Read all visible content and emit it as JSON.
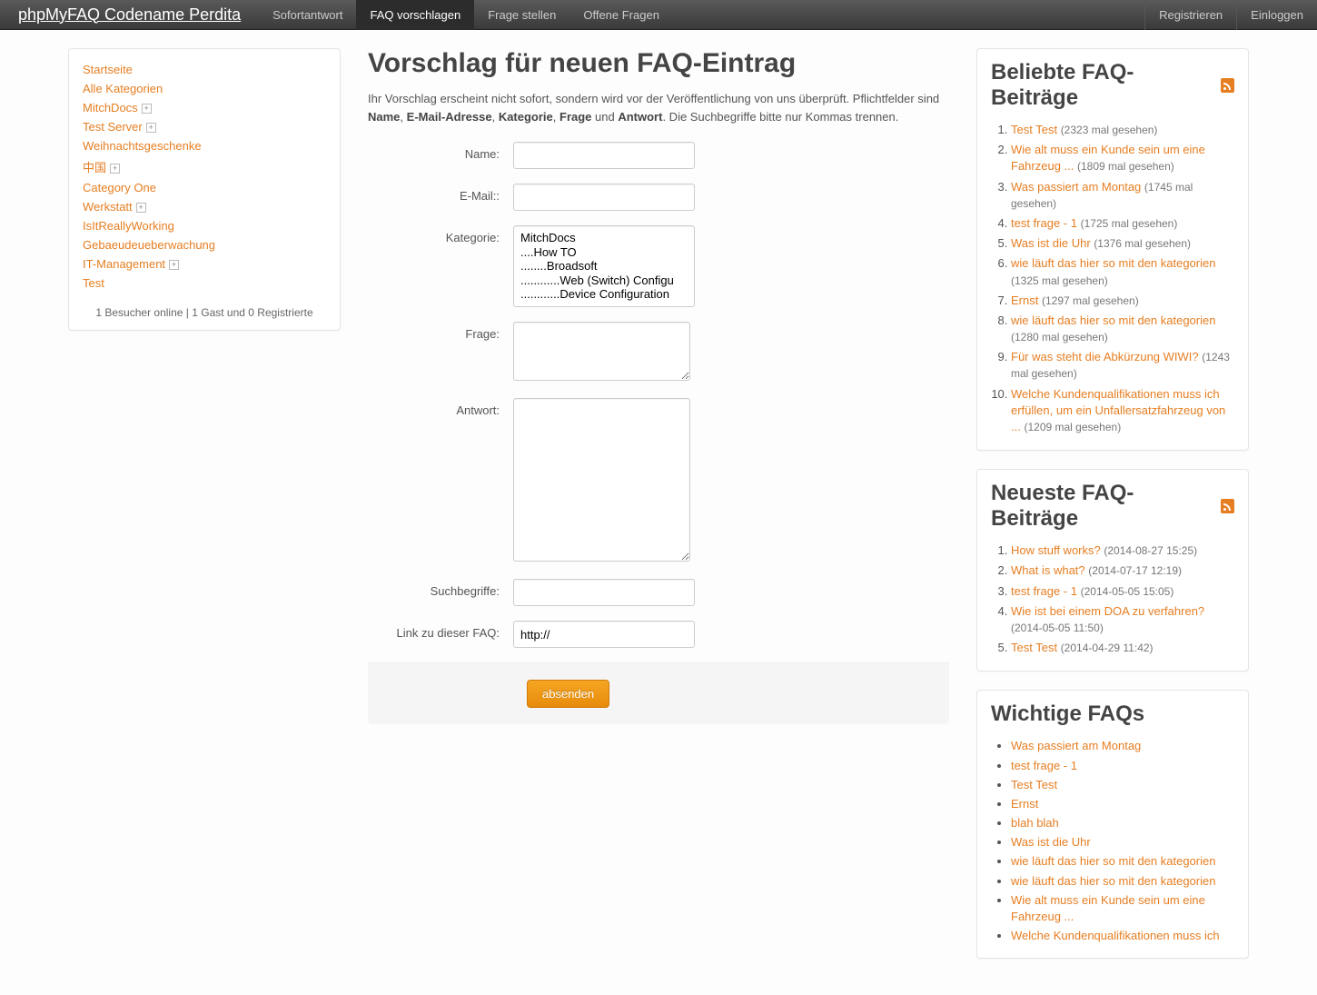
{
  "brand": "phpMyFAQ Codename Perdita",
  "nav": {
    "items": [
      {
        "label": "Sofortantwort",
        "active": false
      },
      {
        "label": "FAQ vorschlagen",
        "active": true
      },
      {
        "label": "Frage stellen",
        "active": false
      },
      {
        "label": "Offene Fragen",
        "active": false
      }
    ],
    "right": [
      {
        "label": "Registrieren"
      },
      {
        "label": "Einloggen"
      }
    ]
  },
  "sidebar": {
    "categories": [
      {
        "label": "Startseite",
        "expandable": false
      },
      {
        "label": "Alle Kategorien",
        "expandable": false
      },
      {
        "label": "MitchDocs",
        "expandable": true
      },
      {
        "label": "Test Server",
        "expandable": true
      },
      {
        "label": "Weihnachtsgeschenke",
        "expandable": false
      },
      {
        "label": "中国",
        "expandable": true
      },
      {
        "label": "Category One",
        "expandable": false
      },
      {
        "label": "Werkstatt",
        "expandable": true
      },
      {
        "label": "IsItReallyWorking",
        "expandable": false
      },
      {
        "label": "Gebaeudeueberwachung",
        "expandable": false
      },
      {
        "label": "IT-Management",
        "expandable": true
      },
      {
        "label": "Test",
        "expandable": false
      }
    ],
    "visitors": "1 Besucher online | 1 Gast und 0 Registrierte"
  },
  "main": {
    "title": "Vorschlag für neuen FAQ-Eintrag",
    "intro_pre": "Ihr Vorschlag erscheint nicht sofort, sondern wird vor der Veröffentlichung von uns überprüft. Pflichtfelder sind ",
    "intro_bold": [
      "Name",
      "E-Mail-Adresse",
      "Kategorie",
      "Frage",
      "Antwort"
    ],
    "intro_joins": [
      ", ",
      ", ",
      ", ",
      " und "
    ],
    "intro_post": ". Die Suchbegriffe bitte nur Kommas trennen.",
    "labels": {
      "name": "Name:",
      "email": "E-Mail::",
      "category": "Kategorie:",
      "question": "Frage:",
      "answer": "Antwort:",
      "keywords": "Suchbegriffe:",
      "link": "Link zu dieser FAQ:"
    },
    "category_options": [
      "MitchDocs",
      "....How TO",
      "........Broadsoft",
      "............Web (Switch) Configu",
      "............Device Configuration"
    ],
    "link_value": "http://",
    "submit": "absenden"
  },
  "popular": {
    "title": "Beliebte FAQ-Beiträge",
    "items": [
      {
        "label": "Test Test",
        "meta": "(2323 mal gesehen)",
        "inline": true
      },
      {
        "label": "Wie alt muss ein Kunde sein um eine Fahrzeug ...",
        "meta": "(1809 mal gesehen)",
        "inline": false
      },
      {
        "label": "Was passiert am Montag",
        "meta": "(1745 mal gesehen)",
        "inline": true
      },
      {
        "label": "test frage - 1",
        "meta": "(1725 mal gesehen)",
        "inline": true
      },
      {
        "label": "Was ist die Uhr",
        "meta": "(1376 mal gesehen)",
        "inline": true
      },
      {
        "label": "wie läuft das hier so mit den kategorien",
        "meta": "(1325 mal gesehen)",
        "inline": false
      },
      {
        "label": "Ernst",
        "meta": "(1297 mal gesehen)",
        "inline": true
      },
      {
        "label": "wie läuft das hier so mit den kategorien",
        "meta": "(1280 mal gesehen)",
        "inline": false
      },
      {
        "label": "Für was steht die Abkürzung WIWI?",
        "meta": "(1243 mal gesehen)",
        "inline": false
      },
      {
        "label": "Welche Kundenqualifikationen muss ich erfüllen, um ein Unfallersatzfahrzeug von ...",
        "meta": "(1209 mal gesehen)",
        "inline": false
      }
    ]
  },
  "newest": {
    "title": "Neueste FAQ-Beiträge",
    "items": [
      {
        "label": "How stuff works?",
        "meta": "(2014-08-27 15:25)"
      },
      {
        "label": "What is what?",
        "meta": "(2014-07-17 12:19)"
      },
      {
        "label": "test frage - 1",
        "meta": "(2014-05-05 15:05)"
      },
      {
        "label": "Wie ist bei einem DOA zu verfahren?",
        "meta": "(2014-05-05 11:50)"
      },
      {
        "label": "Test Test",
        "meta": "(2014-04-29 11:42)"
      }
    ]
  },
  "important": {
    "title": "Wichtige FAQs",
    "items": [
      {
        "label": "Was passiert am Montag"
      },
      {
        "label": "test frage - 1"
      },
      {
        "label": "Test Test"
      },
      {
        "label": "Ernst"
      },
      {
        "label": "blah blah"
      },
      {
        "label": "Was ist die Uhr"
      },
      {
        "label": "wie läuft das hier so mit den kategorien"
      },
      {
        "label": "wie läuft das hier so mit den kategorien"
      },
      {
        "label": "Wie alt muss ein Kunde sein um eine Fahrzeug ..."
      },
      {
        "label": "Welche Kundenqualifikationen muss ich"
      }
    ]
  }
}
